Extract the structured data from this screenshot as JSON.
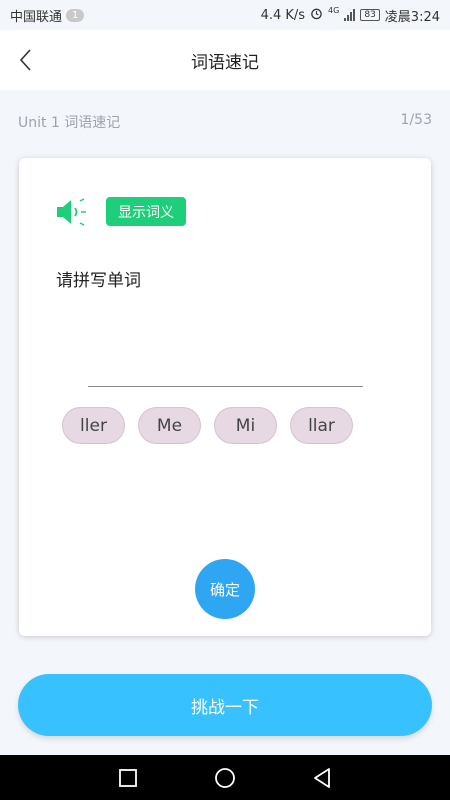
{
  "status": {
    "carrier": "中国联通",
    "notif_count": "1",
    "speed": "4.4 K/s",
    "network": "4G",
    "battery": "83",
    "time": "凌晨3:24"
  },
  "nav": {
    "title": "词语速记"
  },
  "unit": {
    "label": "Unit 1 词语速记",
    "progress": "1/53"
  },
  "card": {
    "show_meaning_label": "显示词义",
    "prompt": "请拼写单词",
    "chips": [
      "ller",
      "Me",
      "Mi",
      "llar"
    ],
    "confirm_label": "确定"
  },
  "challenge_label": "挑战一下",
  "colors": {
    "accent_green": "#1dcf7a",
    "accent_blue": "#37c1ff",
    "confirm_blue": "#2fa6f2"
  }
}
